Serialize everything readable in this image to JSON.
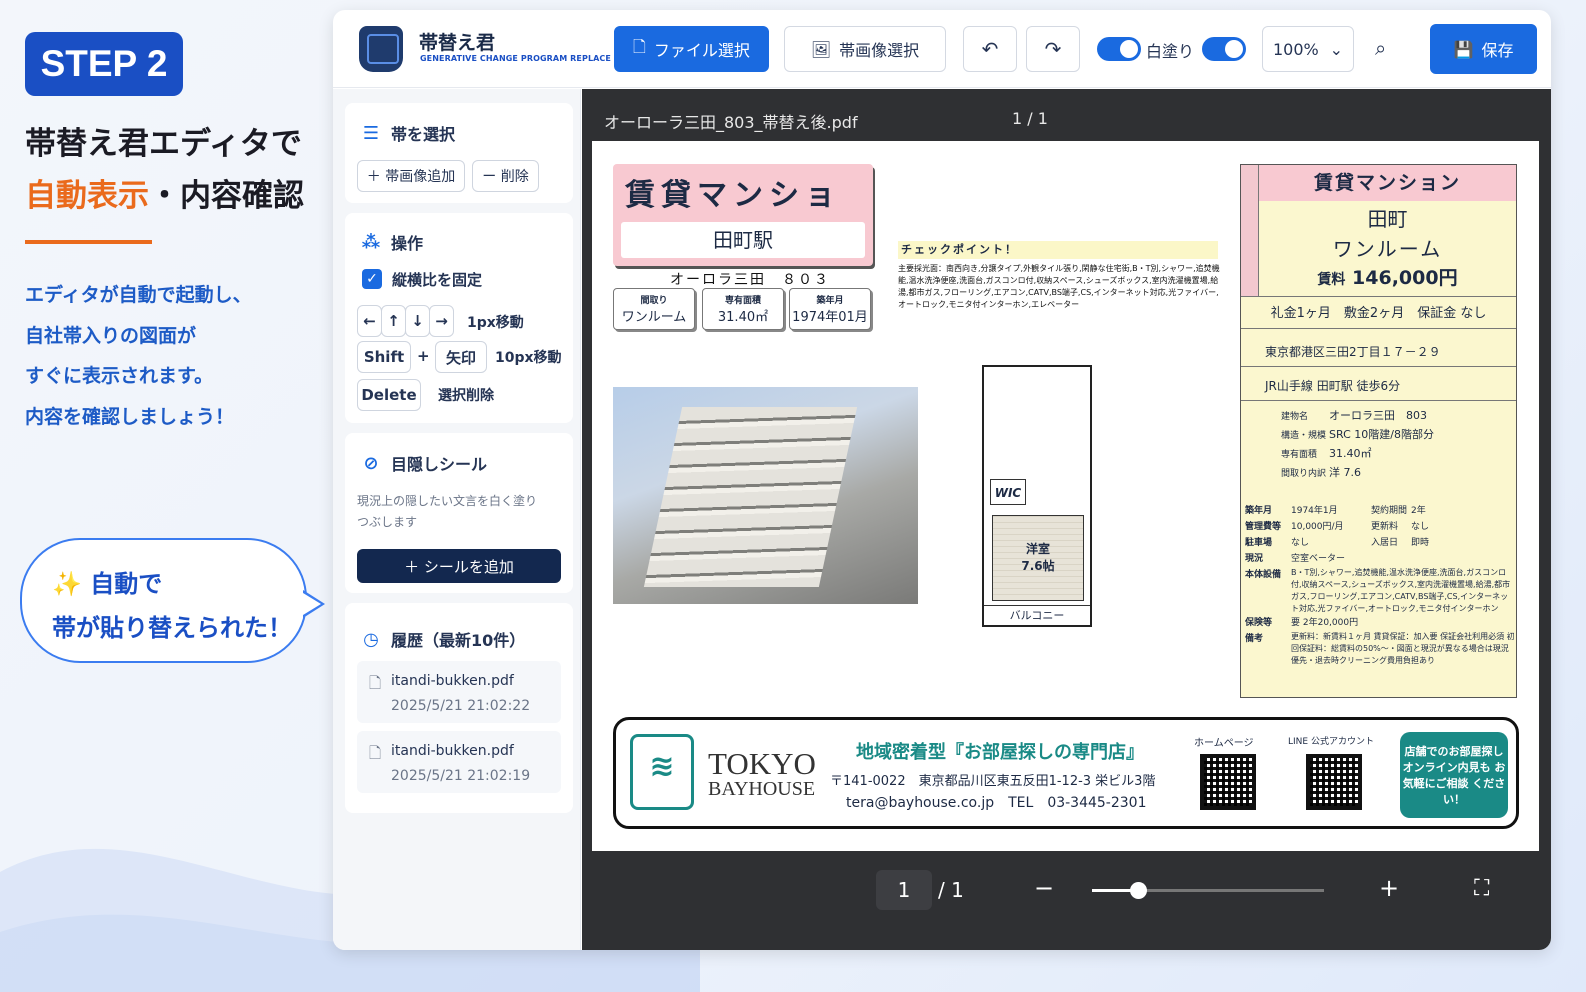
{
  "promo": {
    "step": "STEP 2",
    "headline1": "帯替え君エディタで",
    "headline2_orange": "自動表示",
    "headline2_rest": "・内容確認",
    "desc": [
      "エディタが自動で起動し、",
      "自社帯入りの図面が",
      "すぐに表示されます。",
      "内容を確認しましょう！"
    ],
    "bubble": [
      "✨ 自動で",
      "帯が貼り替えられた！"
    ]
  },
  "app": {
    "title": "帯替え君",
    "subtitle": "GENERATIVE CHANGE PROGRAM REPLACE"
  },
  "toolbar": {
    "file_select": "ファイル選択",
    "band_image_select": "帯画像選択",
    "undo": "↶",
    "redo": "↷",
    "whiteout": "白塗り",
    "zoom": "100%",
    "save": "保存"
  },
  "sidebar": {
    "band_select": {
      "title": "帯を選択",
      "add": "＋ 帯画像追加",
      "delete": "ー 削除"
    },
    "operation": {
      "title": "操作",
      "lock_ratio": "縦横比を固定",
      "arrows": [
        "←",
        "↑",
        "↓",
        "→"
      ],
      "move1": "1px移動",
      "shift": "Shift",
      "plus": "+",
      "arrow_key": "矢印",
      "move10": "10px移動",
      "delete_key": "Delete",
      "delete_sel": "選択削除"
    },
    "seal": {
      "title": "目隠しシール",
      "desc1": "現況上の隠したい文言を白く塗り",
      "desc2": "つぶします",
      "add": "＋ シールを追加"
    },
    "history": {
      "title": "履歴（最新10件）",
      "items": [
        {
          "file": "itandi-bukken.pdf",
          "time": "2025/5/21 21:02:22"
        },
        {
          "file": "itandi-bukken.pdf",
          "time": "2025/5/21 21:02:19"
        }
      ]
    }
  },
  "viewer": {
    "filename": "オーローラ三田_803_帯替え後.pdf",
    "page_header": "1 / 1",
    "page_current": "1",
    "page_total": "/ 1",
    "zoom_minus": "−",
    "zoom_plus": "+",
    "zoom_level": 0.2,
    "fullscreen": "⛶"
  },
  "doc": {
    "title": "賃貸マンション",
    "station": "田町駅",
    "building": "オーロラ三田　８０３",
    "mini": [
      {
        "label": "間取り",
        "value": "ワンルーム"
      },
      {
        "label": "専有面積",
        "value": "31.40㎡"
      },
      {
        "label": "築年月",
        "value": "1974年01月"
      }
    ],
    "check_title": "チェックポイント！",
    "check_text": "主要採光面：南西向き,分譲タイプ,外観タイル張り,閑静な住宅街,B・T別,シャワー,追焚機能,温水洗浄便座,洗面台,ガスコンロ付,収納スペース,シューズボックス,室内洗濯機置場,給湯,都市ガス,フローリング,エアコン,CATV,BS端子,CS,インターネット対応,光ファイバー,オートロック,モニタ付インターホン,エレベーター",
    "fp_room": "洋室",
    "fp_room2": "7.6帖",
    "fp_wic": "WIC",
    "fp_balcony": "バルコニー",
    "r_title": "賃貸マンション",
    "r_area": "田町",
    "r_layout": "ワンルーム",
    "r_rent_label": "賃料",
    "r_rent": "146,000円",
    "r_terms": "礼金1ヶ月　敷金2ヶ月　保証金 なし",
    "r_addr": "東京都港区三田2丁目１７－２９",
    "r_access": "JR山手線 田町駅 徒歩6分",
    "r_table": [
      [
        "建物名",
        "オーロラ三田　803"
      ],
      [
        "構造・規模",
        "SRC 10階建/8階部分"
      ],
      [
        "専有面積",
        "31.40㎡"
      ],
      [
        "間取り内訳",
        "洋 7.6"
      ]
    ],
    "r_table2": [
      [
        "築年月",
        "1974年1月",
        "契約期間",
        "2年"
      ],
      [
        "管理費等",
        "10,000円/月",
        "更新料",
        "なし"
      ],
      [
        "駐車場",
        "なし",
        "入居日",
        "即時"
      ],
      [
        "現況",
        "空室ベーター",
        "",
        ""
      ]
    ],
    "r_equip_label": "本体設備",
    "r_equip": "B・T別,シャワー,追焚機能,温水洗浄便座,洗面台,ガスコンロ付,収納スペース,シューズボックス,室内洗濯機置場,給湯,都市ガス,フローリング,エアコン,CATV,BS端子,CS,インターネット対応,光ファイバー,オートロック,モニタ付インターホン",
    "r_ins_label": "保険等",
    "r_ins": "要 2年20,000円",
    "r_note_label": "備考",
    "r_note": "更新料：新賃料１ヶ月 賃貸保証：加入要 保証会社利用必須 初回保証料：総賃料の50%～・図面と現況が異なる場合は現況優先・退去時クリーニング費用負担あり",
    "band": {
      "company1": "TOKYO",
      "company2": "BAYHOUSE",
      "slogan": "地域密着型『お部屋探しの専門店』",
      "address": "〒141-0022　東京都品川区東五反田1-12-3 栄ビル3階",
      "email": "tera@bayhouse.co.jp",
      "tel_label": "TEL",
      "tel": "03-3445-2301",
      "hp": "ホームページ",
      "line": "LINE 公式アカウント",
      "teal": "店舗でのお部屋探し オンライン内見も お気軽にご相談 ください！"
    }
  }
}
